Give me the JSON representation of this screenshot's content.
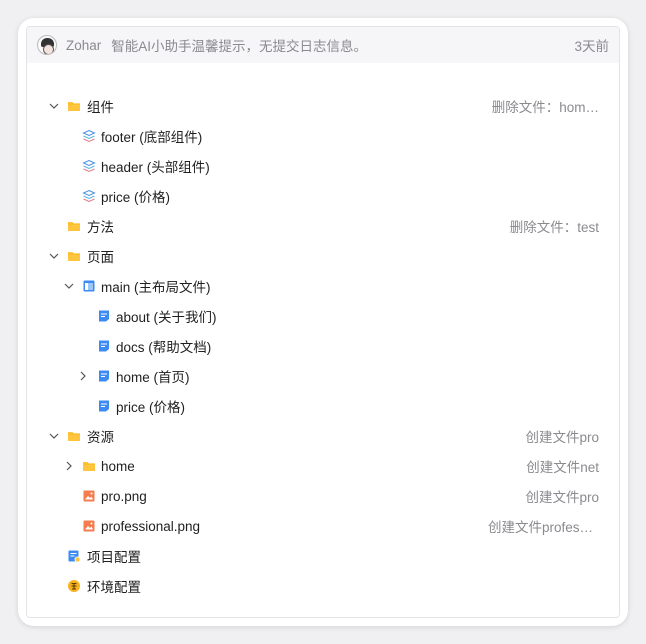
{
  "header": {
    "author": "Zohar",
    "message": "智能AI小助手温馨提示，无提交日志信息。",
    "time": "3天前"
  },
  "tree": [
    {
      "label": "组件",
      "note": "删除文件：hom…",
      "icon": "folder-icon"
    },
    {
      "label": "footer (底部组件)",
      "icon": "component-icon"
    },
    {
      "label": "header (头部组件)",
      "icon": "component-icon"
    },
    {
      "label": "price (价格)",
      "icon": "component-icon"
    },
    {
      "label": "方法",
      "note": "删除文件：test",
      "icon": "folder-icon"
    },
    {
      "label": "页面",
      "icon": "folder-icon"
    },
    {
      "label": "main (主布局文件)",
      "icon": "layout-icon"
    },
    {
      "label": "about (关于我们)",
      "icon": "page-icon"
    },
    {
      "label": "docs (帮助文档)",
      "icon": "page-icon"
    },
    {
      "label": "home (首页)",
      "icon": "page-icon"
    },
    {
      "label": "price (价格)",
      "icon": "page-icon"
    },
    {
      "label": "资源",
      "note": "创建文件pro",
      "icon": "folder-icon"
    },
    {
      "label": "home",
      "note": "创建文件net",
      "icon": "folder-icon"
    },
    {
      "label": "pro.png",
      "note": "创建文件pro",
      "icon": "image-icon"
    },
    {
      "label": "professional.png",
      "note": "创建文件profes…",
      "icon": "image-icon"
    },
    {
      "label": "项目配置",
      "icon": "project-config-icon"
    },
    {
      "label": "环境配置",
      "icon": "environment-config-icon"
    }
  ],
  "colors": {
    "folder": "#FFC53D",
    "page": "#3D8BF2",
    "image": "#F57C4E",
    "muted": "#8A8A8F"
  }
}
